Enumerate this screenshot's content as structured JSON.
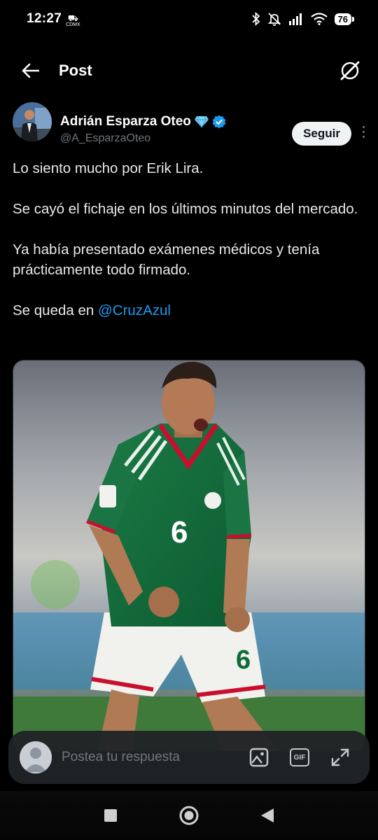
{
  "status_bar": {
    "time": "12:27",
    "carrier_top": "⛟",
    "carrier_label": "CDMX",
    "battery": "76"
  },
  "header": {
    "title": "Post"
  },
  "post": {
    "author_name": "Adrián Esparza Oteo",
    "author_handle": "@A_EsparzaOteo",
    "follow_label": "Seguir",
    "paragraphs": [
      "Lo siento mucho por Erik Lira.",
      "Se cayó el fichaje en los últimos minutos del mercado.",
      "Ya había presentado exámenes médicos y tenía prácticamente todo firmado."
    ],
    "last_prefix": "Se queda en ",
    "mention": "@CruzAzul"
  },
  "media": {
    "jersey_number": "6"
  },
  "reply": {
    "placeholder": "Postea tu respuesta",
    "gif_label": "GIF"
  },
  "colors": {
    "accent": "#1d9bf0",
    "background": "#000000",
    "jersey_green": "#0f6b3a",
    "jersey_red": "#c8102e"
  }
}
